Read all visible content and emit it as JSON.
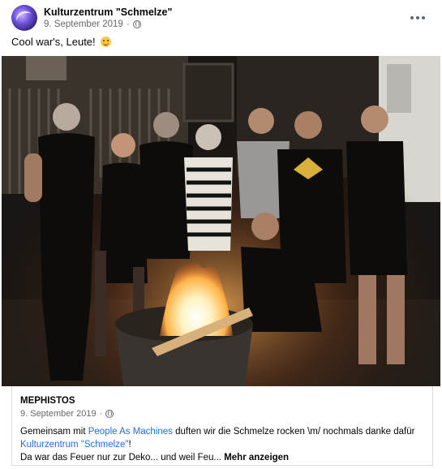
{
  "post": {
    "author": "Kulturzentrum \"Schmelze\"",
    "date": "9. September 2019",
    "separator": "·",
    "text": "Cool war's, Leute!",
    "emoji": "grinning-face-emoji"
  },
  "shared": {
    "author": "MEPHISTOS",
    "date": "9. September 2019",
    "separator": "·",
    "text_part1": "Gemeinsam mit ",
    "link1": "People As Machines",
    "text_part2": " duften wir die Schmelze rocken \\m/ nochmals danke dafür",
    "link2": "Kulturzentrum \"Schmelze\"",
    "text_part3": "!",
    "text_line2": "Da war das Feuer nur zur Deko... und weil Feu... ",
    "more_label": "Mehr anzeigen"
  },
  "photo": {
    "description_icon": "group-photo-fire-pit"
  },
  "colors": {
    "link": "#216fdb",
    "meta": "#65676b"
  }
}
